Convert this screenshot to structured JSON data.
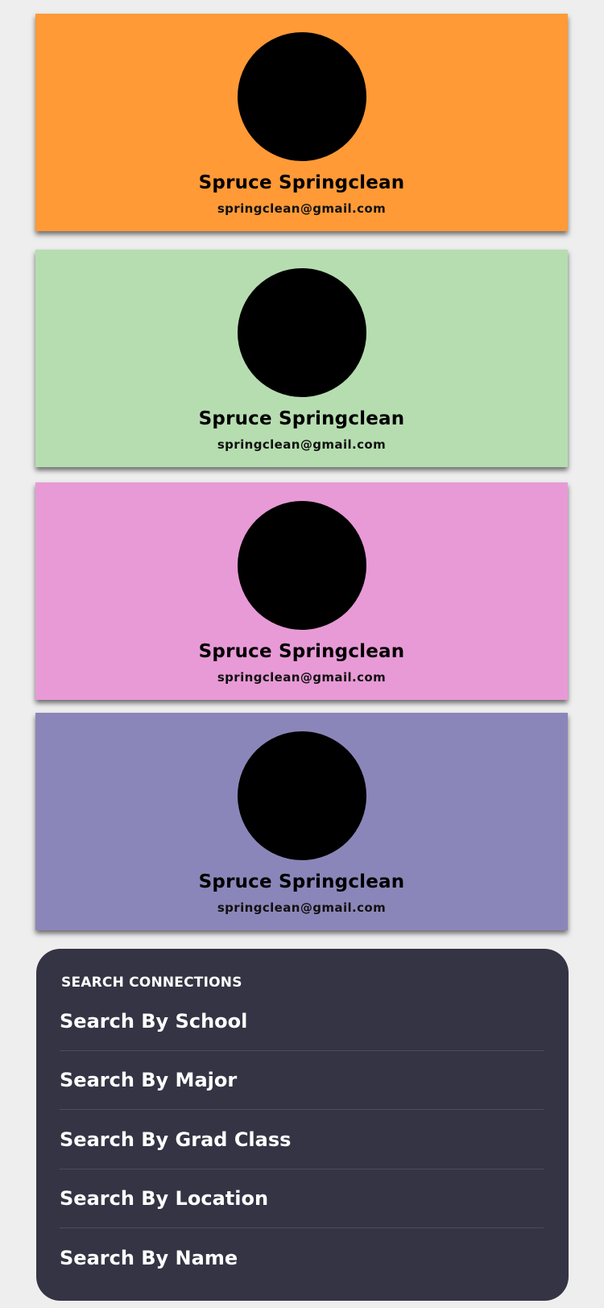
{
  "cards": [
    {
      "name": "Spruce Springclean",
      "email": "springclean@gmail.com",
      "color": "#ff9a36"
    },
    {
      "name": "Spruce Springclean",
      "email": "springclean@gmail.com",
      "color": "#b6ddb0"
    },
    {
      "name": "Spruce Springclean",
      "email": "springclean@gmail.com",
      "color": "#e89ad6"
    },
    {
      "name": "Spruce Springclean",
      "email": "springclean@gmail.com",
      "color": "#8b86b9"
    }
  ],
  "search": {
    "header": "SEARCH CONNECTIONS",
    "panel_color": "#353444",
    "items": [
      {
        "label": "Search By School"
      },
      {
        "label": "Search By Major"
      },
      {
        "label": "Search By Grad Class"
      },
      {
        "label": "Search By Location"
      },
      {
        "label": "Search By Name"
      }
    ]
  }
}
